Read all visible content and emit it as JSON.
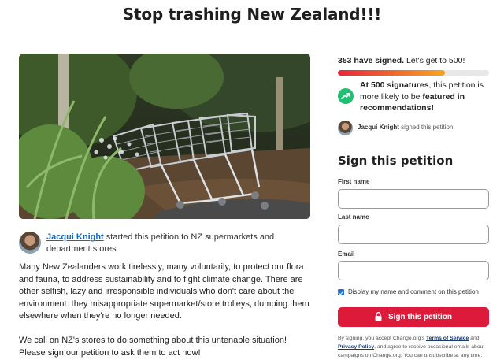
{
  "page": {
    "title": "Stop trashing New Zealand!!!"
  },
  "starter": {
    "name": "Jacqui Knight",
    "action": " started this petition to NZ supermarkets and department stores"
  },
  "body": {
    "paragraphs": [
      "Many New Zealanders work tirelessly, many voluntarily, to protect our flora and fauna, to address sustainability and to fight climate change. There are other selfish, lazy and irresponsible individuals who don't care about the environment:  they misappropriate supermarket/store trolleys, dumping them elsewhere when they're no longer needed.",
      "We call on NZ's stores to do something about this untenable situation! Please sign our petition to ask them to act now!"
    ]
  },
  "sidebar": {
    "signed_count": "353 have signed.",
    "goal_text": " Let's get to 500!",
    "progress_fraction": 0.706,
    "milestone_bold1": "At 500 signatures",
    "milestone_mid": ", this petition is more likely to be ",
    "milestone_bold2": "featured in recommendations!",
    "recent_signer": "Jacqui Knight",
    "recent_action": " signed this petition"
  },
  "form": {
    "heading": "Sign this petition",
    "first_name_label": "First name",
    "first_name_value": "",
    "last_name_label": "Last name",
    "last_name_value": "",
    "email_label": "Email",
    "email_value": "",
    "display_option": "Display my name and comment on this petition",
    "display_checked": true,
    "submit_label": "Sign this petition"
  },
  "legal": {
    "prefix": "By signing, you accept Change.org's ",
    "terms_link": "Terms of Service",
    "and": " and ",
    "privacy_link": "Privacy Policy",
    "suffix": ", and agree to receive occasional emails about campaigns on Change.org. You can unsubscribe at any time."
  },
  "icons": {
    "trend": "trending-up-icon",
    "lock": "lock-icon"
  },
  "colors": {
    "brand_red": "#de1a3a",
    "link_blue": "#1667b8",
    "trend_green": "#1fbf74",
    "progress_start": "#e8263b",
    "progress_end": "#f5a623"
  }
}
